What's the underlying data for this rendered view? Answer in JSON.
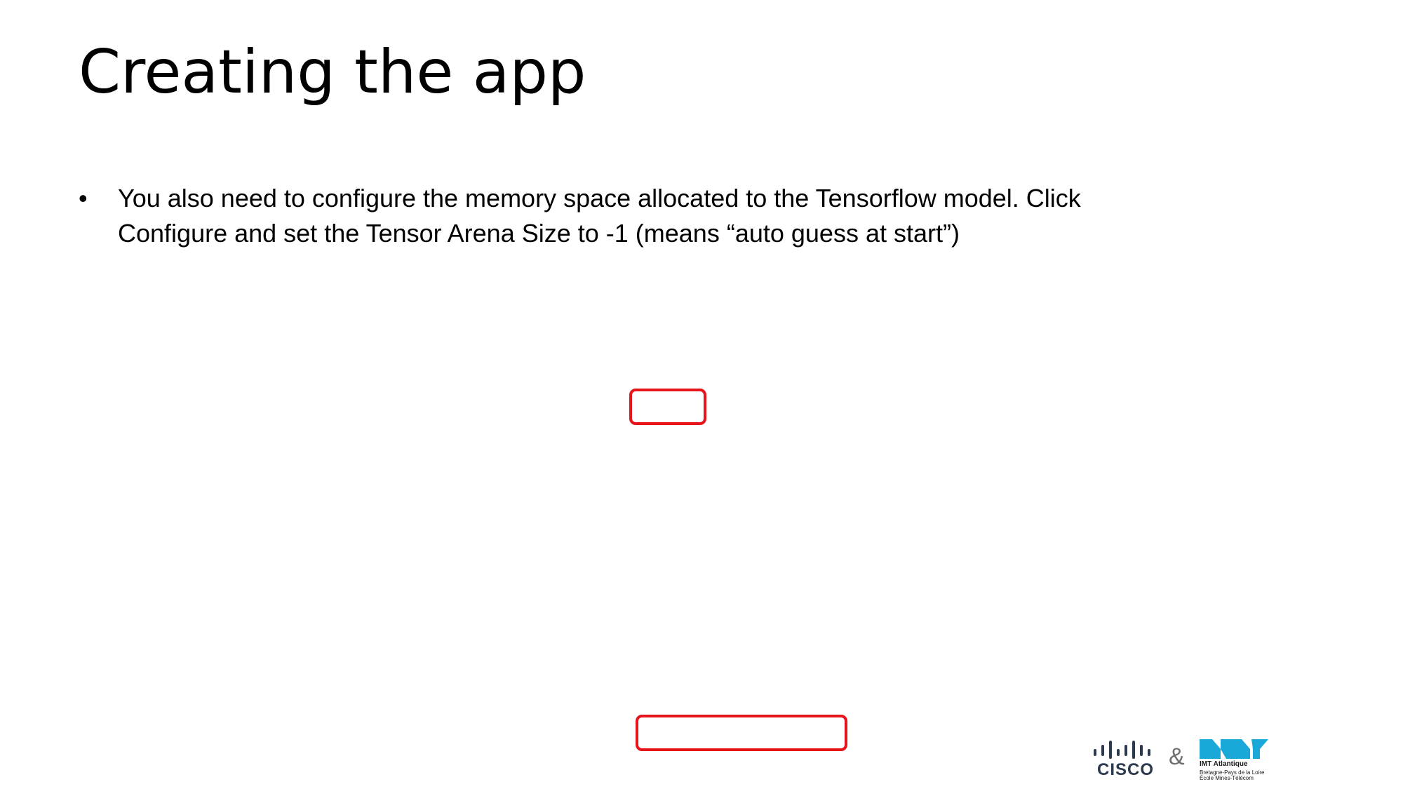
{
  "slide": {
    "title": "Creating the app",
    "bullets": [
      {
        "marker": "•",
        "text": "You also need to configure the memory space allocated to the Tensorflow model. Click Configure and set the Tensor Arena Size to -1 (means “auto guess at start”)"
      }
    ]
  },
  "colors": {
    "highlight": "#e8141b",
    "cisco_blue": "#2b3a4e",
    "imt_cyan": "#1aa8d8"
  },
  "footer": {
    "cisco_logo_text": "CISCO",
    "ampersand": "&",
    "imt_name": "IMT Atlantique",
    "imt_subtitle_1": "Bretagne-Pays de la Loire",
    "imt_subtitle_2": "École Mines-Télécom"
  }
}
